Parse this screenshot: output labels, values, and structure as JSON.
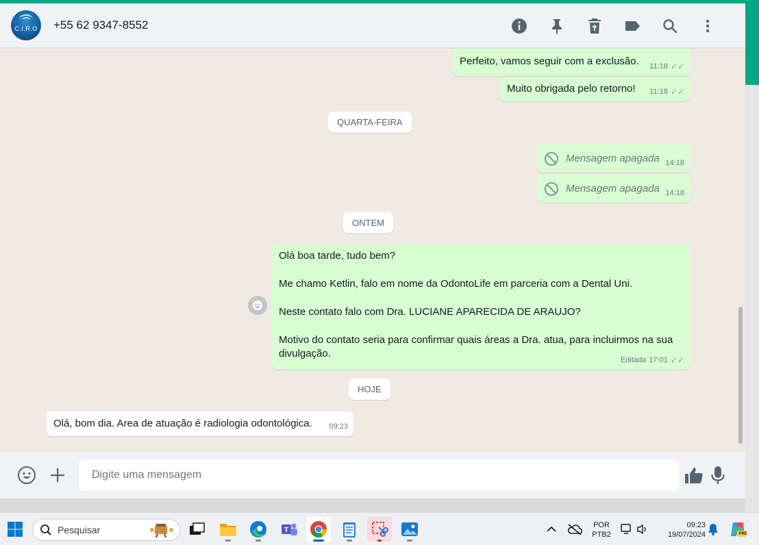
{
  "header": {
    "contact": "+55 62 9347-8552",
    "avatar_text": "C.I.R.O",
    "icons": [
      "info-icon",
      "pin-icon",
      "delete-icon",
      "label-icon",
      "search-icon",
      "more-icon"
    ]
  },
  "messages": {
    "m1": {
      "text": "Perfeito, vamos seguir com a exclusão.",
      "time": "11:18"
    },
    "m2": {
      "text": "Muito obrigada pelo retorno!",
      "time": "11:18"
    },
    "day1": "QUARTA-FEIRA",
    "d1": {
      "text": "Mensagem apagada",
      "time": "14:18"
    },
    "d2": {
      "text": "Mensagem apagada",
      "time": "14:18"
    },
    "day2": "ONTEM",
    "long": {
      "line1": "Olá boa tarde, tudo bem?",
      "line2": "Me chamo Ketlin, falo em nome da OdontoLife em parceria com a Dental Uni.",
      "line3": "Neste contato falo com Dra. LUCIANE APARECIDA DE ARAUJO?",
      "line4": "Motivo do contato seria para confirmar quais áreas a Dra. atua, para incluirmos na sua divulgação.",
      "edited": "Editada",
      "time": "17:01"
    },
    "day3": "HOJE",
    "in1": {
      "text": "Olá, bom dia. Area de atuação é radiologia odontológica.",
      "time": "09:23"
    }
  },
  "composer": {
    "placeholder": "Digite uma mensagem"
  },
  "taskbar": {
    "search": "Pesquisar",
    "lang1": "POR",
    "lang2": "PTB2",
    "time": "09:23",
    "date": "19/07/2024",
    "badge": "PRE"
  },
  "colors": {
    "accent": "#00a884",
    "outgoing": "#d9fdd3",
    "incoming": "#ffffff",
    "chat_bg": "#efeae2"
  }
}
